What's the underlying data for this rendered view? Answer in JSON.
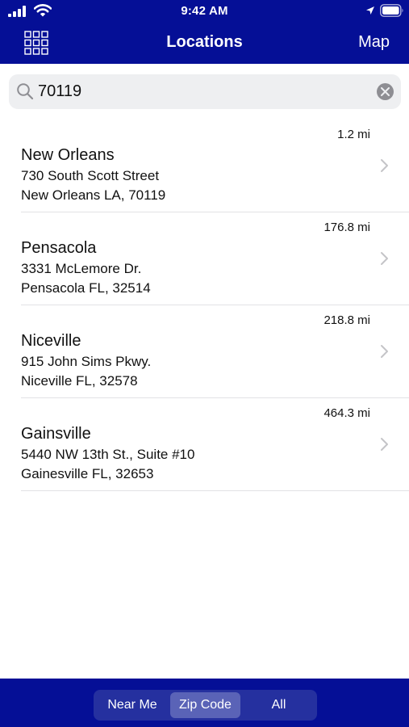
{
  "status_bar": {
    "time": "9:42 AM"
  },
  "nav": {
    "title": "Locations",
    "map_label": "Map"
  },
  "search": {
    "value": "70119"
  },
  "locations": [
    {
      "distance": "1.2 mi",
      "name": "New Orleans",
      "address_line1": "730 South Scott Street",
      "address_line2": "New Orleans LA, 70119"
    },
    {
      "distance": "176.8 mi",
      "name": "Pensacola",
      "address_line1": "3331 McLemore Dr.",
      "address_line2": "Pensacola FL, 32514"
    },
    {
      "distance": "218.8 mi",
      "name": "Niceville",
      "address_line1": "915 John Sims Pkwy.",
      "address_line2": "Niceville FL, 32578"
    },
    {
      "distance": "464.3 mi",
      "name": "Gainsville",
      "address_line1": "5440 NW 13th St., Suite #10",
      "address_line2": "Gainesville FL, 32653"
    }
  ],
  "segments": {
    "selected": "Zip Code",
    "items": [
      "Near Me",
      "Zip Code",
      "All"
    ]
  },
  "colors": {
    "brand": "#050f96",
    "segment_bg": "#25309f",
    "segment_selected": "#5a63b7",
    "search_bg": "#eeeff1"
  }
}
